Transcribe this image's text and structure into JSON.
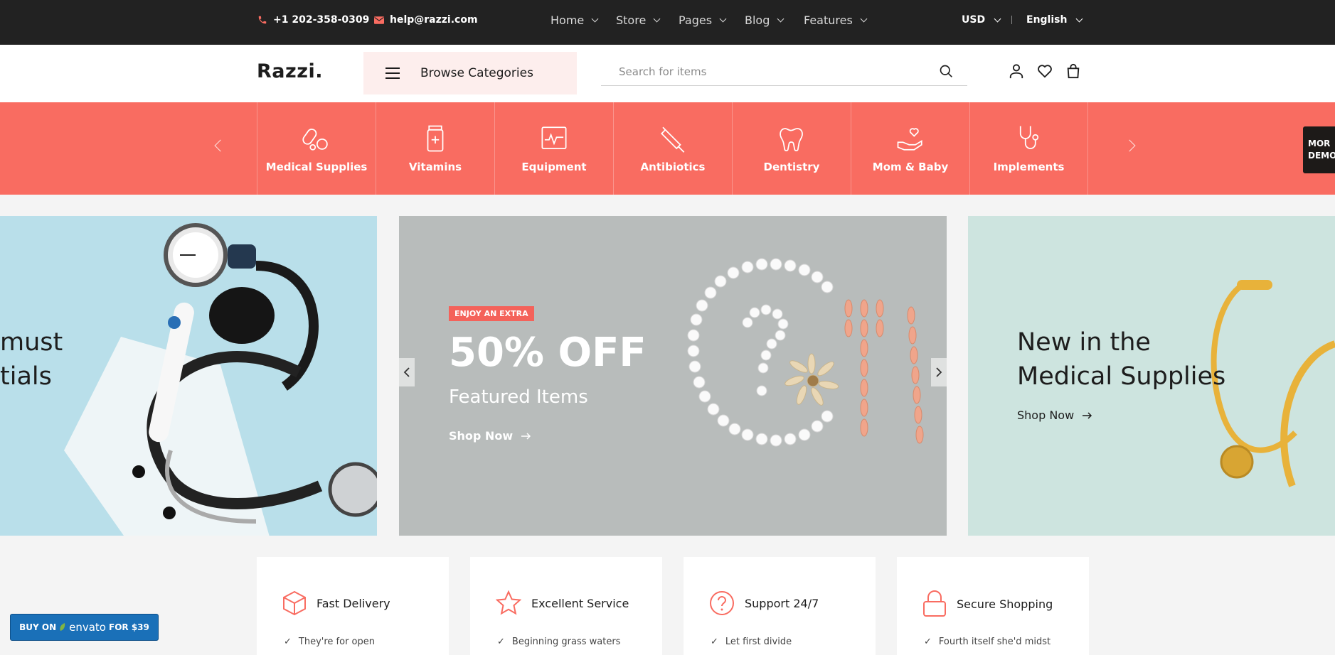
{
  "topbar": {
    "phone": "+1 202-358-0309",
    "email": "help@razzi.com",
    "nav": [
      "Home",
      "Store",
      "Pages",
      "Blog",
      "Features"
    ],
    "currency": "USD",
    "language": "English"
  },
  "header": {
    "logo": "Razzi.",
    "browse_label": "Browse Categories",
    "search_placeholder": "Search for items"
  },
  "categories": [
    {
      "label": "Medical Supplies",
      "icon": "pills-icon"
    },
    {
      "label": "Vitamins",
      "icon": "vitamin-bottle-icon"
    },
    {
      "label": "Equipment",
      "icon": "monitor-icon"
    },
    {
      "label": "Antibiotics",
      "icon": "syringe-icon"
    },
    {
      "label": "Dentistry",
      "icon": "tooth-icon"
    },
    {
      "label": "Mom & Baby",
      "icon": "heart-hand-icon"
    },
    {
      "label": "Implements",
      "icon": "stethoscope-icon"
    }
  ],
  "more_demos": {
    "line1": "MOR",
    "line2": "DEMO"
  },
  "banners": {
    "left": {
      "line1": "must",
      "line2": "tials"
    },
    "center": {
      "tag": "ENJOY AN EXTRA",
      "headline": "50% OFF",
      "subtitle": "Featured Items",
      "cta": "Shop Now"
    },
    "right": {
      "line1": "New in the",
      "line2": "Medical Supplies",
      "cta": "Shop Now"
    }
  },
  "features": [
    {
      "title": "Fast Delivery",
      "text": "They're for open",
      "icon": "box-icon"
    },
    {
      "title": "Excellent Service",
      "text": "Beginning grass waters",
      "icon": "star-icon"
    },
    {
      "title": "Support 24/7",
      "text": "Let first divide",
      "icon": "question-icon"
    },
    {
      "title": "Secure Shopping",
      "text": "Fourth itself she'd midst",
      "icon": "lock-icon"
    }
  ],
  "envato": {
    "prefix": "BUY ON",
    "brand": "envato",
    "suffix": "FOR $39"
  },
  "colors": {
    "accent": "#f96c61",
    "topbar": "#222222"
  }
}
